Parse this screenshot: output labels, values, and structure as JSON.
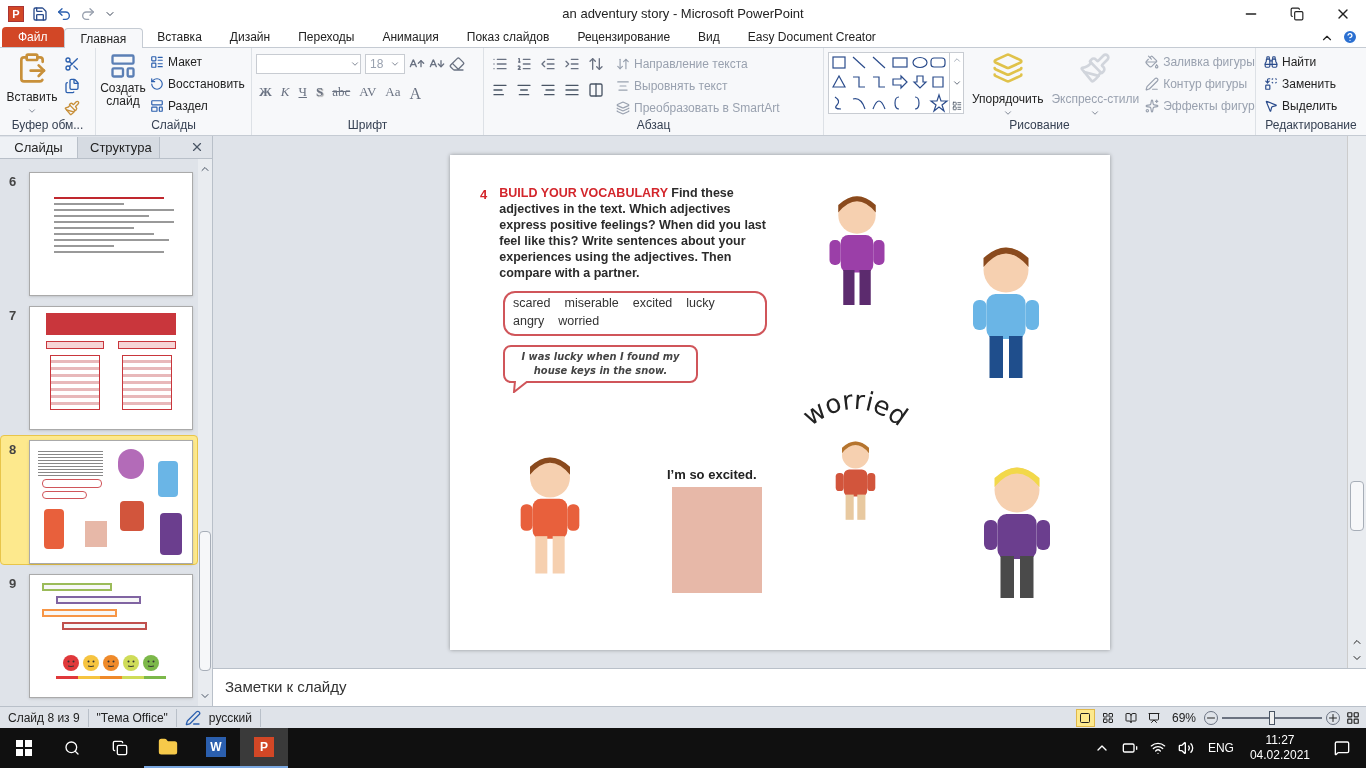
{
  "window": {
    "app_letter": "P",
    "title": "an adventury story - Microsoft PowerPoint"
  },
  "ribbon_tabs": [
    {
      "label": "Файл",
      "kind": "file",
      "selected": false
    },
    {
      "label": "Главная",
      "kind": "tab",
      "selected": true
    },
    {
      "label": "Вставка",
      "kind": "tab",
      "selected": false
    },
    {
      "label": "Дизайн",
      "kind": "tab",
      "selected": false
    },
    {
      "label": "Переходы",
      "kind": "tab",
      "selected": false
    },
    {
      "label": "Анимация",
      "kind": "tab",
      "selected": false
    },
    {
      "label": "Показ слайдов",
      "kind": "tab",
      "selected": false
    },
    {
      "label": "Рецензирование",
      "kind": "tab",
      "selected": false
    },
    {
      "label": "Вид",
      "kind": "tab",
      "selected": false
    },
    {
      "label": "Easy Document Creator",
      "kind": "tab",
      "selected": false
    }
  ],
  "clipboard": {
    "label": "Буфер обм...",
    "paste": "Вставить"
  },
  "slides_group": {
    "label": "Слайды",
    "new_slide": "Создать слайд",
    "buttons": [
      "Макет",
      "Восстановить",
      "Раздел"
    ]
  },
  "font_group": {
    "label": "Шрифт",
    "size": "18",
    "format_buttons": [
      {
        "label": "Ж",
        "kind": "bold"
      },
      {
        "label": "К",
        "kind": "italic"
      },
      {
        "label": "Ч",
        "kind": "underline"
      },
      {
        "label": "S",
        "kind": "shadow"
      },
      {
        "label": "abc",
        "kind": "strike"
      },
      {
        "label": "AV",
        "kind": "spacing"
      },
      {
        "label": "Aa",
        "kind": "case"
      },
      {
        "label": "A",
        "kind": "color"
      }
    ]
  },
  "paragraph_group": {
    "label": "Абзац",
    "buttons": [
      {
        "label": "Направление текста",
        "disabled": true
      },
      {
        "label": "Выровнять текст",
        "disabled": true
      },
      {
        "label": "Преобразовать в SmartArt",
        "disabled": true
      }
    ]
  },
  "drawing_group": {
    "label": "Рисование",
    "arrange": "Упорядочить",
    "quick_styles": {
      "label": "Экспресс-стили",
      "disabled": true
    },
    "buttons": [
      {
        "label": "Заливка фигуры",
        "disabled": true
      },
      {
        "label": "Контур фигуры",
        "disabled": true
      },
      {
        "label": "Эффекты фигур",
        "disabled": true
      }
    ]
  },
  "editing_group": {
    "label": "Редактирование",
    "buttons": [
      {
        "label": "Найти",
        "kind": "find"
      },
      {
        "label": "Заменить",
        "kind": "replace"
      },
      {
        "label": "Выделить",
        "kind": "select"
      }
    ]
  },
  "pane_tabs": [
    {
      "label": "Слайды",
      "selected": true
    },
    {
      "label": "Структура",
      "selected": false
    }
  ],
  "thumbnails": [
    {
      "number": "6",
      "kind": "exercise",
      "selected": false
    },
    {
      "number": "7",
      "kind": "verbs",
      "selected": false
    },
    {
      "number": "8",
      "kind": "preview",
      "selected": true
    },
    {
      "number": "9",
      "kind": "questions",
      "selected": false,
      "questions": [
        {
          "color": "#9bbb59"
        },
        {
          "color": "#8064a2"
        },
        {
          "color": "#f79646"
        },
        {
          "color": "#c0504d"
        }
      ],
      "faces": [
        {
          "color": "#e0383b"
        },
        {
          "color": "#f6c440"
        },
        {
          "color": "#ef8a2a"
        },
        {
          "color": "#cfdc58"
        },
        {
          "color": "#7cb84a"
        }
      ]
    }
  ],
  "slide": {
    "task_number": "4",
    "heading": "BUILD YOUR VOCABULARY",
    "instruction": "Find these adjectives in the text. Which adjectives express positive feelings? When did you last feel like this? Write sentences about your experiences using the adjectives. Then compare with a partner.",
    "words": [
      "scared",
      "miserable",
      "excited",
      "lucky",
      "angry",
      "worried"
    ],
    "example": "I was lucky when I found my house keys in the snow.",
    "photo_caption": "I’m so excited.",
    "arc_word": "worried"
  },
  "notes": {
    "placeholder": "Заметки к слайду"
  },
  "status_bar": {
    "items": [
      "Слайд 8 из 9",
      "\"Тема Office\"",
      "русский"
    ],
    "views": [
      {
        "kind": "normal",
        "selected": true
      },
      {
        "kind": "sorter",
        "selected": false
      },
      {
        "kind": "reading",
        "selected": false
      },
      {
        "kind": "show",
        "selected": false
      }
    ],
    "zoom": "69%",
    "zoom_level": {
      "level": 0.5
    }
  },
  "taskbar": {
    "apps": [
      {
        "kind": "explorer",
        "selected": false
      },
      {
        "kind": "word",
        "letter": "W",
        "selected": false
      },
      {
        "kind": "powerpoint",
        "letter": "P",
        "selected": true
      }
    ],
    "language": "ENG",
    "time": "11:27",
    "date": "04.02.2021"
  }
}
